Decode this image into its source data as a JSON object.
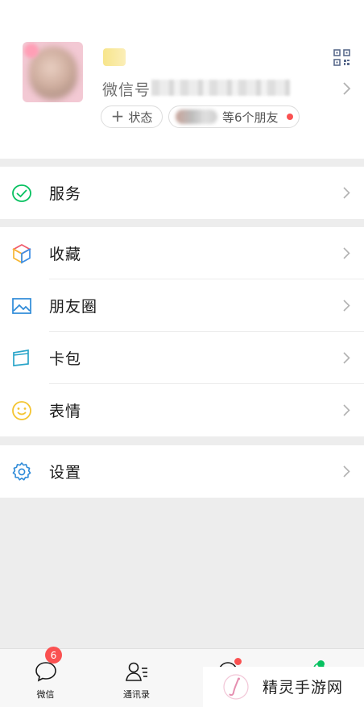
{
  "profile": {
    "wechat_id_label": "微信号",
    "status_button": "状态",
    "friends_text": "等6个朋友"
  },
  "menu": {
    "services": "服务",
    "favorites": "收藏",
    "moments": "朋友圈",
    "cards": "卡包",
    "stickers": "表情",
    "settings": "设置"
  },
  "tabbar": {
    "chats_label": "微信",
    "contacts_label": "通讯录",
    "chats_badge": "6"
  },
  "watermark": {
    "brand": "精灵手游网"
  },
  "colors": {
    "accent_green": "#07c160",
    "badge_red": "#fa5151",
    "background": "#ededed"
  }
}
